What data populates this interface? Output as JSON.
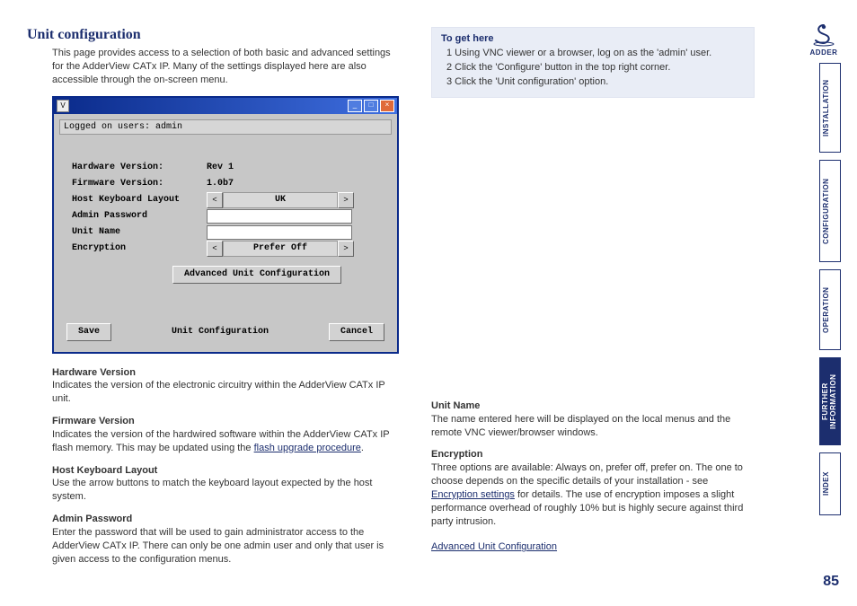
{
  "title": "Unit configuration",
  "intro": "This page provides access to a selection of both basic and advanced settings for the AdderView CATx IP. Many of the settings displayed here are also accessible through the on-screen menu.",
  "window": {
    "status": "Logged on users: admin",
    "rows": {
      "hw_label": "Hardware Version:",
      "hw_value": "Rev 1",
      "fw_label": "Firmware Version:",
      "fw_value": "1.0b7",
      "kb_label": "Host Keyboard Layout",
      "kb_value": "UK",
      "pw_label": "Admin Password",
      "name_label": "Unit Name",
      "enc_label": "Encryption",
      "enc_value": "Prefer Off"
    },
    "adv_btn": "Advanced Unit Configuration",
    "save": "Save",
    "footer_title": "Unit Configuration",
    "cancel": "Cancel"
  },
  "left_desc": {
    "hw_h": "Hardware Version",
    "hw_t": "Indicates the version of the electronic circuitry within the AdderView CATx IP unit.",
    "fw_h": "Firmware Version",
    "fw_t1": "Indicates the version of the hardwired software within the AdderView CATx IP flash memory. This may be updated using the ",
    "fw_link": "flash upgrade procedure",
    "fw_t2": ".",
    "kb_h": "Host Keyboard Layout",
    "kb_t": "Use the arrow buttons to match the keyboard layout expected by the host system.",
    "pw_h": "Admin Password",
    "pw_t": "Enter the password that will be used to gain administrator access to the AdderView CATx IP. There can only be one admin user and only that user is given access to the configuration menus."
  },
  "togethere": {
    "heading": "To get here",
    "s1": "1  Using VNC viewer or a browser, log on as the 'admin' user.",
    "s2": "2  Click the 'Configure' button in the top right corner.",
    "s3": "3  Click the 'Unit configuration' option."
  },
  "right_desc": {
    "un_h": "Unit Name",
    "un_t": "The name entered here will be displayed on the local menus and the remote VNC viewer/browser windows.",
    "en_h": "Encryption",
    "en_t1": "Three options are available: Always on, prefer off, prefer on. The one to choose depends on the specific details of your installation - see ",
    "en_link": "Encryption settings",
    "en_t2": " for details. The use of encryption imposes a slight performance overhead of roughly 10% but is highly secure against third party intrusion.",
    "adv_link": "Advanced Unit Configuration"
  },
  "nav": {
    "t1": "INSTALLATION",
    "t2": "CONFIGURATION",
    "t3": "OPERATION",
    "t4a": "FURTHER",
    "t4b": "INFORMATION",
    "t5": "INDEX"
  },
  "brand": "ADDER",
  "page_number": "85"
}
